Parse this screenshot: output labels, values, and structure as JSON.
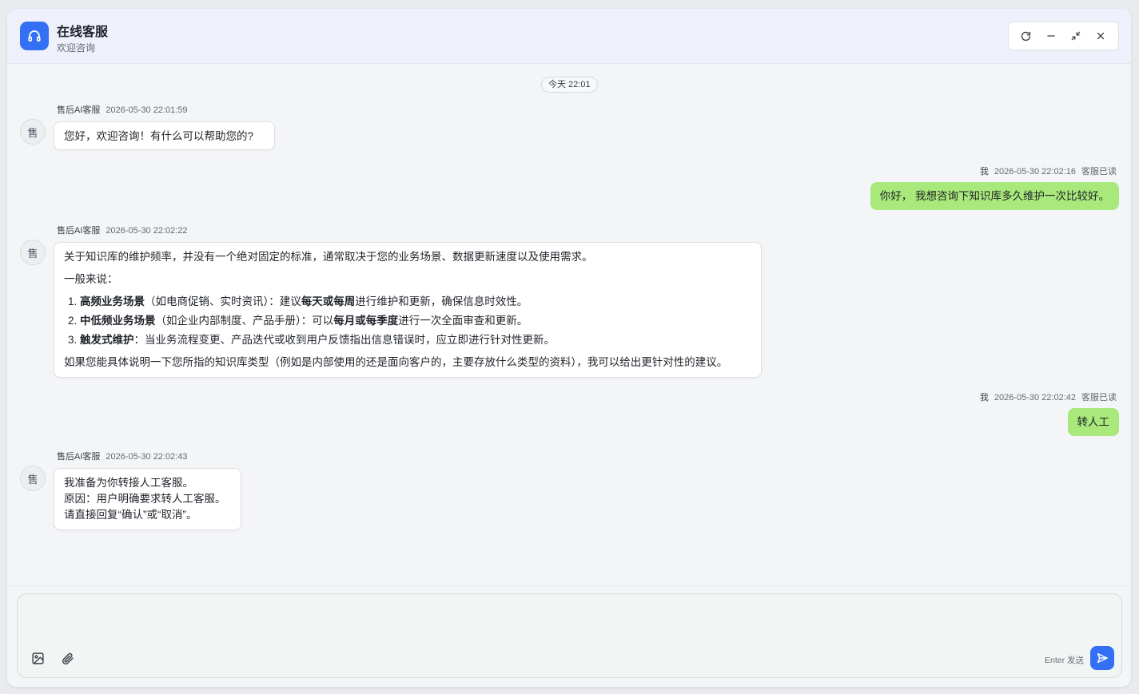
{
  "header": {
    "title": "在线客服",
    "subtitle": "欢迎咨询",
    "icon": "headset-icon",
    "controls": [
      "refresh-icon",
      "minimize-icon",
      "collapse-icon",
      "close-icon"
    ]
  },
  "chat": {
    "time_chip": "今天 22:01",
    "avatar_label": "售",
    "messages": [
      {
        "sender": "售后AI客服",
        "time": "2026-05-30 22:01:59",
        "text": "您好，欢迎咨询！有什么可以帮助您的?"
      },
      {
        "sender": "我",
        "time": "2026-05-30 22:02:16",
        "status": "客服已读",
        "text": "你好， 我想咨询下知识库多久维护一次比较好。"
      },
      {
        "sender": "售后AI客服",
        "time": "2026-05-30 22:02:22",
        "intro": "关于知识库的维护频率，并没有一个绝对固定的标准，通常取决于您的业务场景、数据更新速度以及使用需求。",
        "lead": "一般来说：",
        "items": [
          {
            "title": "高频业务场景",
            "before": "（如电商促销、实时资讯）：建议",
            "strong": "每天或每周",
            "after": "进行维护和更新，确保信息时效性。"
          },
          {
            "title": "中低频业务场景",
            "before": "（如企业内部制度、产品手册）：可以",
            "strong": "每月或每季度",
            "after": "进行一次全面审查和更新。"
          },
          {
            "title": "触发式维护",
            "before": "：当业务流程变更、产品迭代或收到用户反馈指出信息错误时，应立即进行针对性更新。",
            "strong": "",
            "after": ""
          }
        ],
        "outro": "如果您能具体说明一下您所指的知识库类型（例如是内部使用的还是面向客户的，主要存放什么类型的资料），我可以给出更针对性的建议。"
      },
      {
        "sender": "我",
        "time": "2026-05-30 22:02:42",
        "status": "客服已读",
        "text": "转人工"
      },
      {
        "sender": "售后AI客服",
        "time": "2026-05-30 22:02:43",
        "lines": [
          "我准备为你转接人工客服。",
          "原因：用户明确要求转人工客服。",
          "请直接回复“确认”或“取消”。"
        ]
      }
    ]
  },
  "composer": {
    "value": "",
    "hint": "Enter 发送",
    "tools": [
      "image-icon",
      "paperclip-icon"
    ],
    "send_icon": "send-icon"
  },
  "colors": {
    "accent": "#3370f5",
    "user_bubble": "#a9e87a",
    "bot_bubble": "#ffffff"
  }
}
